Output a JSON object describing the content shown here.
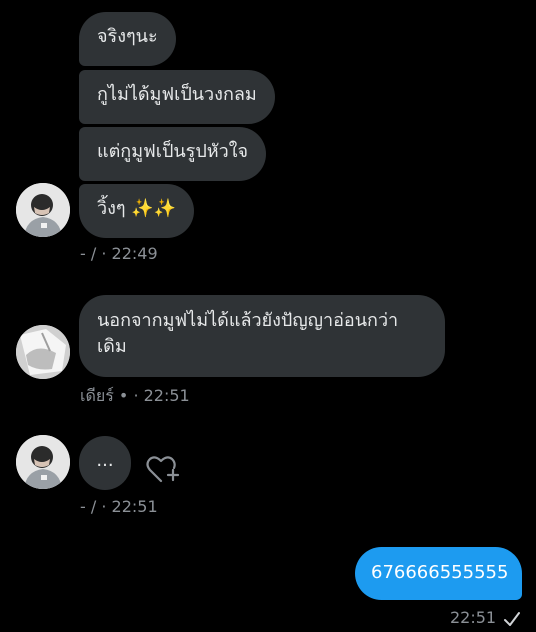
{
  "conversation": {
    "group1": {
      "messages": [
        {
          "text": "จริงๆนะ"
        },
        {
          "text": "กูไม่ได้มูฟเป็นวงกลม"
        },
        {
          "text": "แต่กูมูฟเป็นรูปหัวใจ"
        },
        {
          "text": "วิ้งๆ ✨✨"
        }
      ],
      "meta": "- / · 22:49",
      "avatar_icon": "profile-photo"
    },
    "group2": {
      "message": "นอกจากมูฟไม่ได้แล้วยังปัญญาอ่อนกว่าเดิม",
      "meta": "เดียร์ • · 22:51",
      "avatar_icon": "profile-photo"
    },
    "group3": {
      "message": "...",
      "meta": "- / · 22:51",
      "reaction_icon": "add-reaction-heart-icon",
      "avatar_icon": "profile-photo"
    },
    "sent": {
      "message": "676666555555",
      "time": "22:51",
      "status_icon": "check-icon"
    }
  },
  "colors": {
    "background": "#000000",
    "received_bubble": "#2f3336",
    "sent_bubble": "#1d9bf0",
    "meta_text": "#8b9096"
  }
}
